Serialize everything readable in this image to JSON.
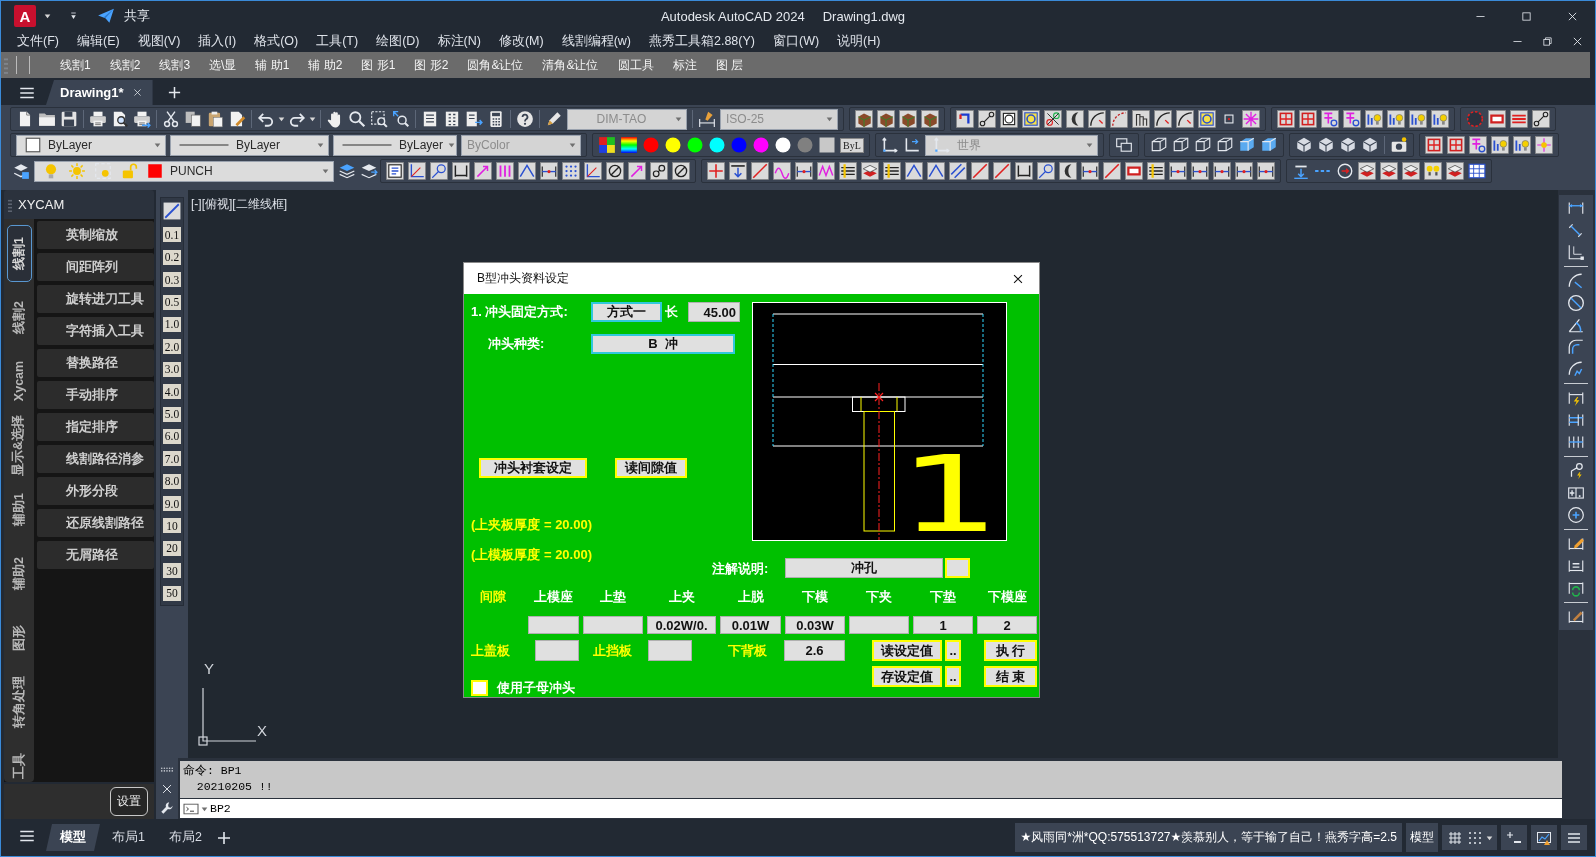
{
  "title_bar": {
    "logo": "A",
    "share": "共享",
    "app": "Autodesk AutoCAD 2024",
    "document": "Drawing1.dwg"
  },
  "menu_bar": [
    "文件(F)",
    "编辑(E)",
    "视图(V)",
    "插入(I)",
    "格式(O)",
    "工具(T)",
    "绘图(D)",
    "标注(N)",
    "修改(M)",
    "线割编程(w)",
    "燕秀工具箱2.88(Y)",
    "窗口(W)",
    "说明(H)"
  ],
  "custom_toolbar": [
    "线割1",
    "线割2",
    "线割3",
    "选\\显",
    "辅 助1",
    "辅 助2",
    "图 形1",
    "图 形2",
    "圆角&让位",
    "清角&让位",
    "圆工具",
    "标注",
    "图 层"
  ],
  "document_tabs": [
    {
      "label": "Drawing1*",
      "selected": true
    }
  ],
  "toolbars": {
    "text_style": {
      "value": "DIM-TAO",
      "disabled": true
    },
    "dimension_style": {
      "value": "ISO-25",
      "disabled": true
    },
    "color": {
      "value": "ByLayer",
      "disabled": false
    },
    "linetype": {
      "value": "ByLayer",
      "disabled": false
    },
    "lineweight": {
      "value": "ByLayer",
      "disabled": false
    },
    "plot_style": {
      "value": "ByColor",
      "disabled": true
    },
    "color_buttons": [
      {
        "kind": "circle",
        "color": "#ff0000"
      },
      {
        "kind": "circle",
        "color": "#ffff00"
      },
      {
        "kind": "circle",
        "color": "#00ff00"
      },
      {
        "kind": "circle",
        "color": "#00ffff"
      },
      {
        "kind": "circle",
        "color": "#0000ff"
      },
      {
        "kind": "circle",
        "color": "#ff00ff"
      },
      {
        "kind": "circle",
        "color": "#ffffff"
      },
      {
        "kind": "circle",
        "color": "#808080"
      },
      {
        "kind": "square",
        "color": "#c8c8c8"
      }
    ],
    "bylayer_button": "ByL",
    "ucs": {
      "value": "世界",
      "disabled": true
    },
    "layer": {
      "value": "PUNCH",
      "disabled": false
    }
  },
  "palette": {
    "title": "XYCAM",
    "tabs": [
      {
        "label": "线割1",
        "selected": true
      },
      {
        "label": "线割2",
        "selected": false
      },
      {
        "label": "Xycam",
        "selected": false
      },
      {
        "label": "显示&选择",
        "selected": false
      },
      {
        "label": "辅助1",
        "selected": false
      },
      {
        "label": "辅助2",
        "selected": false
      },
      {
        "label": "图形",
        "selected": false
      },
      {
        "label": "转角处理",
        "selected": false
      },
      {
        "label": "工具",
        "selected": false
      }
    ],
    "buttons": [
      "英制缩放",
      "间距阵列",
      "旋转进刀工具",
      "字符插入工具",
      "替换路径",
      "手动排序",
      "指定排序",
      "线割路径消参",
      "外形分段",
      "还原线割路径",
      "无屑路径"
    ],
    "settings_button": "设置"
  },
  "scale_buttons": [
    "0.1",
    "0.2",
    "0.3",
    "0.5",
    "1.0",
    "2.0",
    "3.0",
    "4.0",
    "5.0",
    "6.0",
    "7.0",
    "8.0",
    "9.0",
    "10",
    "20",
    "30",
    "50"
  ],
  "viewport": {
    "label": "[-][俯视][二维线框]",
    "ucs_y": "Y",
    "ucs_x": "X"
  },
  "dialog": {
    "title": "B型冲头资料设定",
    "mount_label": "1. 冲头固定方式:",
    "mount_button": "方式一",
    "length_label": "长",
    "length_value": "45.00",
    "type_label": "冲头种类:",
    "type_button": "B  冲",
    "bushing_button": "冲头衬套设定",
    "read_clearance_button": "读间隙值",
    "thickness_notes": [
      "(上夹板厚度 = 20.00)",
      "(上模板厚度 = 20.00)"
    ],
    "preview_number": "1",
    "note_label": "注解说明:",
    "note_value": "冲孔",
    "clearance_label": "间隙",
    "clearance": [
      {
        "header": "上模座"
      },
      {
        "header": "上垫"
      },
      {
        "header": "上夹",
        "value": "0.02W/0."
      },
      {
        "header": "上脱",
        "value": "0.01W"
      },
      {
        "header": "下模",
        "value": "0.03W"
      },
      {
        "header": "下夹"
      },
      {
        "header": "下垫",
        "value": "1"
      },
      {
        "header": "下模座",
        "value": "2"
      }
    ],
    "plates": [
      {
        "label": "上盖板"
      },
      {
        "label": "止挡板"
      },
      {
        "label": "下背板",
        "value": "2.6"
      }
    ],
    "settings_buttons": [
      {
        "label": "读设定值",
        "browse": ".."
      },
      {
        "label": "存设定值",
        "browse": ".."
      }
    ],
    "action_buttons": [
      "执 行",
      "结 束"
    ],
    "child_punch": {
      "label": "使用子母冲头",
      "checked": false
    }
  },
  "command_line": {
    "history": [
      "命令: BP1",
      "  20210205 !!"
    ],
    "input": "BP2"
  },
  "status_bar": {
    "layout_tabs": [
      {
        "label": "模型",
        "selected": true
      },
      {
        "label": "布局1",
        "selected": false
      },
      {
        "label": "布局2",
        "selected": false
      }
    ],
    "message": "★风雨同*洲*QQ:575513727★羡慕别人，等于输了自己！燕秀字高=2.5",
    "space": "模型"
  }
}
